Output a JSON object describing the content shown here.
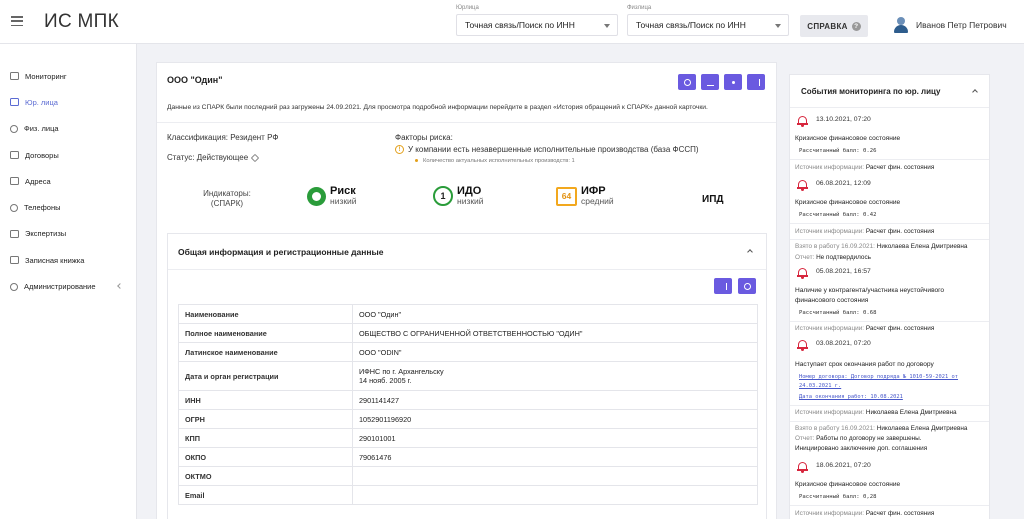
{
  "header": {
    "app_title": "ИС МПК",
    "legal": {
      "label": "Юрлица",
      "value": "Точная связь/Поиск по ИНН"
    },
    "physical": {
      "label": "Физлица",
      "value": "Точная связь/Поиск по ИНН"
    },
    "help_label": "СПРАВКА",
    "help_icon": "?",
    "user_name": "Иванов Петр Петрович"
  },
  "sidebar": {
    "items": [
      {
        "label": "Мониторинг",
        "icon": "monitor-icon"
      },
      {
        "label": "Юр. лица",
        "icon": "building-icon",
        "active": true
      },
      {
        "label": "Физ. лица",
        "icon": "users-icon"
      },
      {
        "label": "Договоры",
        "icon": "contract-icon"
      },
      {
        "label": "Адреса",
        "icon": "address-icon"
      },
      {
        "label": "Телефоны",
        "icon": "phone-icon"
      },
      {
        "label": "Экспертизы",
        "icon": "expertise-icon"
      },
      {
        "label": "Записная книжка",
        "icon": "notebook-icon"
      },
      {
        "label": "Администрирование",
        "icon": "gear-icon",
        "has_submenu": true
      }
    ]
  },
  "company": {
    "name": "ООО \"Один\"",
    "load_note": "Данные из СПАРК были последний раз загружены 24.09.2021. Для просмотра подробной информации перейдите в раздел «История обращений к СПАРК» данной карточки.",
    "classification": "Классификация: Резидент РФ",
    "status": "Статус: Действующее",
    "risk_factors_title": "Факторы риска:",
    "risk_factor": "У компании есть незавершенные исполнительные производства (база ФССП)",
    "risk_sub": "Количество актуальных исполнительных производств: 1"
  },
  "indicators": {
    "label_line1": "Индикаторы:",
    "label_line2": "(СПАРК)",
    "risk": {
      "title": "Риск",
      "level": "низкий"
    },
    "ido": {
      "value": "1",
      "title": "ИДО",
      "level": "низкий"
    },
    "ifr": {
      "value": "64",
      "title": "ИФР",
      "level": "средний"
    },
    "ipd": {
      "title": "ИПД"
    }
  },
  "general": {
    "title": "Общая информация и регистрационные данные",
    "rows": [
      {
        "key": "Наименование",
        "value": "ООО \"Один\""
      },
      {
        "key": "Полное наименование",
        "value": "ОБЩЕСТВО С ОГРАНИЧЕННОЙ ОТВЕТСТВЕННОСТЬЮ \"ОДИН\""
      },
      {
        "key": "Латинское наименование",
        "value": "OOO \"ODIN\""
      },
      {
        "key": "Дата и орган регистрации",
        "value": "ИФНС по г. Архангельску",
        "value2": "14 нояб. 2005 г."
      },
      {
        "key": "ИНН",
        "value": "2901141427"
      },
      {
        "key": "ОГРН",
        "value": "1052901196920"
      },
      {
        "key": "КПП",
        "value": "290101001"
      },
      {
        "key": "ОКПО",
        "value": "79061476"
      },
      {
        "key": "ОКТМО",
        "value": ""
      },
      {
        "key": "Email",
        "value": ""
      }
    ]
  },
  "events": {
    "title": "События мониторинга по юр. лицу",
    "source_label": "Источник информации:",
    "taken_label": "Взято в работу 16.09.2021:",
    "report_label": "Отчет:",
    "items": [
      {
        "date": "13.10.2021, 07:20",
        "text": "Кризисное финансовое состояние",
        "score": "Рассчитанный балл: 0.26",
        "source": "Расчет фин. состояния"
      },
      {
        "date": "06.08.2021, 12:09",
        "text": "Кризисное финансовое состояние",
        "score": "Рассчитанный балл: 0.42",
        "source": "Расчет фин. состояния",
        "taken": "Николаева Елена Дмитриевна",
        "report": "Не подтвердилось"
      },
      {
        "date": "05.08.2021, 16:57",
        "text1": "Наличие у контрагента/участника неустойчивого",
        "text2": "финансового состояния",
        "score": "Рассчитанный балл: 0.68",
        "source": "Расчет фин. состояния"
      },
      {
        "date": "03.08.2021, 07:20",
        "text": "Наступает срок окончания работ по договору",
        "link1": "Номер договора: Договор подряда № 1010-59-2021 от",
        "link2": "24.03.2021 г.",
        "link3": "Дата окончания работ: 10.08.2021",
        "source": "Николаева Елена Дмитриевна",
        "taken": "Николаева Елена Дмитриевна",
        "report1": "Работы по договору не завершены.",
        "report2": "Инициировано заключение доп. соглашения"
      },
      {
        "date": "18.06.2021, 07:20",
        "text": "Кризисное финансовое состояние",
        "score": "Рассчитанный балл: 0,28",
        "source": "Расчет фин. состояния"
      }
    ]
  }
}
